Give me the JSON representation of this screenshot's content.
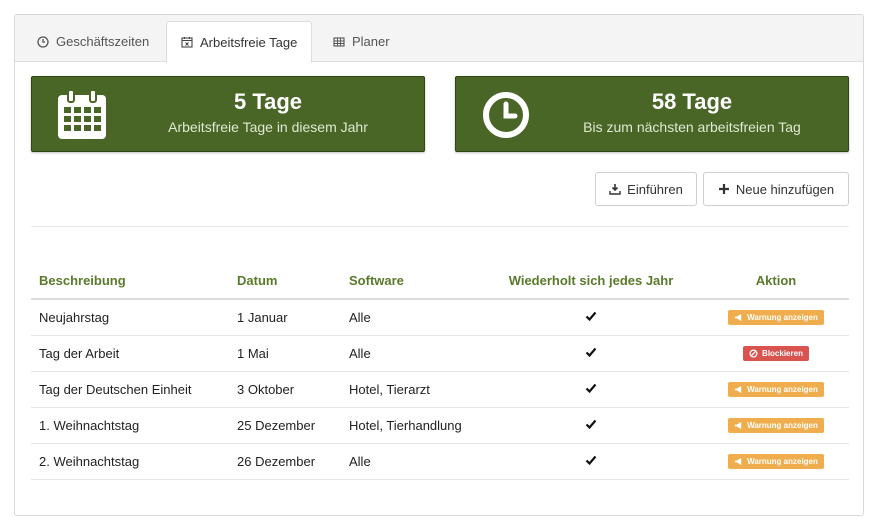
{
  "tabs": [
    {
      "label": "Geschäftszeiten",
      "icon": "clock-icon"
    },
    {
      "label": "Arbeitsfreie Tage",
      "icon": "calendar-x-icon"
    },
    {
      "label": "Planer",
      "icon": "table-icon"
    }
  ],
  "active_tab": "Arbeitsfreie Tage",
  "stats": [
    {
      "value": "5 Tage",
      "caption": "Arbeitsfreie Tage in diesem Jahr",
      "icon": "calendar-icon"
    },
    {
      "value": "58 Tage",
      "caption": "Bis zum nächsten arbeitsfreien Tag",
      "icon": "clock-icon"
    }
  ],
  "actions": {
    "import_label": "Einführen",
    "add_label": "Neue hinzufügen"
  },
  "table": {
    "headers": [
      "Beschreibung",
      "Datum",
      "Software",
      "Wiederholt sich jedes Jahr",
      "Aktion"
    ],
    "rows": [
      {
        "description": "Neujahrstag",
        "date": "1 Januar",
        "software": "Alle",
        "repeats": true,
        "action": "Warnung anzeigen",
        "action_type": "warning"
      },
      {
        "description": "Tag der Arbeit",
        "date": "1 Mai",
        "software": "Alle",
        "repeats": true,
        "action": "Blockieren",
        "action_type": "block"
      },
      {
        "description": "Tag der Deutschen Einheit",
        "date": "3 Oktober",
        "software": "Hotel, Tierarzt",
        "repeats": true,
        "action": "Warnung anzeigen",
        "action_type": "warning"
      },
      {
        "description": "1. Weihnachtstag",
        "date": "25 Dezember",
        "software": "Hotel, Tierhandlung",
        "repeats": true,
        "action": "Warnung anzeigen",
        "action_type": "warning"
      },
      {
        "description": "2. Weihnachtstag",
        "date": "26 Dezember",
        "software": "Alle",
        "repeats": true,
        "action": "Warnung anzeigen",
        "action_type": "warning"
      }
    ]
  },
  "colors": {
    "stat_bg": "#4a6626",
    "header_text": "#5a7a2a",
    "warning": "#f0ad4e",
    "block": "#d9534f"
  }
}
